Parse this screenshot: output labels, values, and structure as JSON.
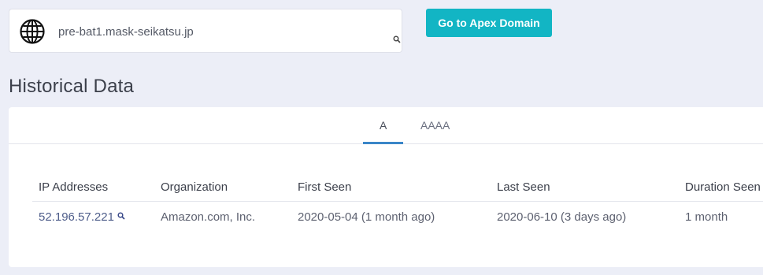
{
  "search": {
    "value": "pre-bat1.mask-seikatsu.jp",
    "globe_icon": "globe-icon",
    "search_icon": "search-icon"
  },
  "apex_button": {
    "label": "Go to Apex Domain",
    "color": "#12b5c4"
  },
  "page_title": "Historical Data",
  "tabs": [
    {
      "label": "A",
      "active": true
    },
    {
      "label": "AAAA",
      "active": false
    }
  ],
  "accent_color": "#3a86c8",
  "table": {
    "headers": [
      "IP Addresses",
      "Organization",
      "First Seen",
      "Last Seen",
      "Duration Seen"
    ],
    "rows": [
      {
        "ip": "52.196.57.221",
        "organization": "Amazon.com, Inc.",
        "first_seen": "2020-05-04 (1 month ago)",
        "last_seen": "2020-06-10 (3 days ago)",
        "duration": "1 month"
      }
    ]
  }
}
